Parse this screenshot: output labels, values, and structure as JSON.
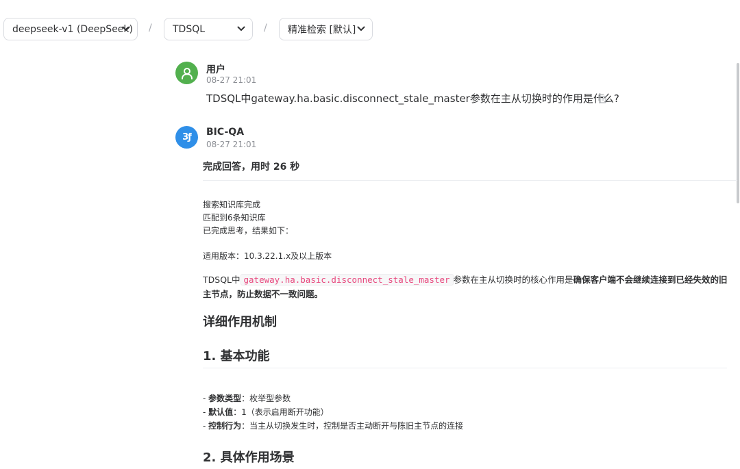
{
  "toolbar": {
    "model_select": "deepseek-v1 (DeepSeek)",
    "kb_select": "TDSQL",
    "mode_select": "精准检索 [默认]",
    "separator": "/"
  },
  "messages": {
    "user": {
      "name": "用户",
      "time": "08-27 21:01",
      "text": "TDSQL中gateway.ha.basic.disconnect_stale_master参数在主从切换时的作用是什么?"
    },
    "bot": {
      "name": "BIC-QA",
      "time": "08-27 21:01",
      "avatar_text": "3ƒ"
    }
  },
  "answer": {
    "done_label": "完成回答，用时 26 秒",
    "status_lines": [
      "搜索知识库完成",
      "匹配到6条知识库",
      "已完成思考，结果如下："
    ],
    "version_line": "适用版本：10.3.22.1.x及以上版本",
    "intro_prefix": "TDSQL中",
    "intro_code": "gateway.ha.basic.disconnect_stale_master",
    "intro_mid": "参数在主从切换时的核心作用是",
    "intro_bold": "确保客户端不会继续连接到已经失效的旧主节点，防止数据不一致问题。",
    "heading_main": "详细作用机制",
    "heading_1": "1. 基本功能",
    "list": [
      {
        "dash": "- ",
        "label": "参数类型",
        "text": "：枚举型参数"
      },
      {
        "dash": "- ",
        "label": "默认值",
        "text": "：1（表示启用断开功能）"
      },
      {
        "dash": "- ",
        "label": "控制行为",
        "text": "：当主从切换发生时，控制是否主动断开与陈旧主节点的连接"
      }
    ],
    "heading_2": "2. 具体作用场景"
  },
  "colors": {
    "user_avatar": "#52b04e",
    "bot_avatar": "#2f8fe8",
    "code_text": "#e8467c"
  }
}
